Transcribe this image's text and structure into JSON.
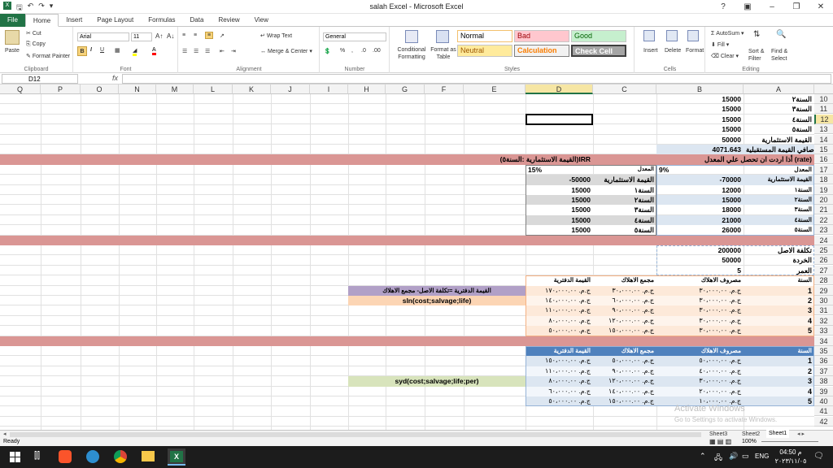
{
  "window": {
    "title": "salah Excel  -  Microsoft Excel"
  },
  "tabs": [
    "File",
    "Home",
    "Insert",
    "Page Layout",
    "Formulas",
    "Data",
    "Review",
    "View"
  ],
  "ribbon": {
    "clipboard": {
      "label": "Clipboard",
      "paste": "Paste",
      "cut": "Cut",
      "copy": "Copy",
      "format_painter": "Format Painter"
    },
    "font": {
      "label": "Font",
      "name": "Arial",
      "size": "11"
    },
    "alignment": {
      "label": "Alignment",
      "wrap": "Wrap Text",
      "merge": "Merge & Center"
    },
    "number": {
      "label": "Number",
      "format": "General"
    },
    "styles": {
      "label": "Styles",
      "conditional": "Conditional Formatting",
      "format_table": "Format as Table",
      "normal": "Normal",
      "bad": "Bad",
      "good": "Good",
      "neutral": "Neutral",
      "calculation": "Calculation",
      "check": "Check Cell"
    },
    "cells": {
      "label": "Cells",
      "insert": "Insert",
      "delete": "Delete",
      "format": "Format"
    },
    "editing": {
      "label": "Editing",
      "autosum": "AutoSum",
      "fill": "Fill",
      "clear": "Clear",
      "sort": "Sort & Filter",
      "find": "Find & Select"
    }
  },
  "formula_bar": {
    "name_box": "D12",
    "fx": "fx",
    "value": ""
  },
  "columns": [
    "Q",
    "P",
    "O",
    "N",
    "M",
    "L",
    "K",
    "J",
    "I",
    "H",
    "G",
    "F",
    "E",
    "D",
    "C",
    "B",
    "A"
  ],
  "rows": [
    "10",
    "11",
    "12",
    "13",
    "14",
    "15",
    "16",
    "17",
    "18",
    "19",
    "20",
    "21",
    "22",
    "23",
    "24",
    "25",
    "26",
    "27",
    "28",
    "29",
    "30",
    "31",
    "32",
    "33",
    "34",
    "35",
    "36",
    "37",
    "38",
    "39",
    "40",
    "41",
    "42"
  ],
  "cells": {
    "r10b": "15000",
    "r10a": "السنة٢",
    "r11b": "15000",
    "r11a": "السنة٣",
    "r12b": "15000",
    "r12a": "السنة٤",
    "r13b": "15000",
    "r13a": "السنة٥",
    "r14b": "50000",
    "r14a": "القيمة الاستثمارية",
    "r15b": "4071.643",
    "r15a": "صافي القيمة المستقبلية",
    "r16ab": "أذا اردت ان تحصل علي المعدل (rate)",
    "r16de": "(القيمة الاستثمارية :السنة٥)IRR",
    "r17d": "15%",
    "r17c": "المعدل",
    "r17b": "9%",
    "r17a": "المعدل",
    "r18d": "-50000",
    "r18c": "القيمة الاستثمارية",
    "r18b": "-70000",
    "r18a": "القيمة الاستثمارية",
    "r19d": "15000",
    "r19c": "السنة١",
    "r19b": "12000",
    "r19a": "السنة١",
    "r20d": "15000",
    "r20c": "السنة٢",
    "r20b": "15000",
    "r20a": "السنة٢",
    "r21d": "15000",
    "r21c": "السنة٣",
    "r21b": "18000",
    "r21a": "السنة٣",
    "r22d": "15000",
    "r22c": "السنة٤",
    "r22b": "21000",
    "r22a": "السنة٤",
    "r23d": "15000",
    "r23c": "السنة٥",
    "r23b": "26000",
    "r23a": "السنة٥",
    "r25b": "200000",
    "r25a": "تكلفة الاصل",
    "r26b": "50000",
    "r26a": "الخردة",
    "r27b": "5",
    "r27a": "العمر",
    "r28d": "القيمة الدفترية",
    "r28c": "مجمع الاهلاك",
    "r28b": "مصروف الاهلاك",
    "r28a": "السنة",
    "r29eh": "القيمة الدفترية =تكلفة الاصل- مجمع الاهلاك",
    "r30eh": "sln(cost;salvage;life)",
    "r35d": "القيمة الدفترية",
    "r35c": "مجمع الاهلاك",
    "r35b": "مصروف الاهلاك",
    "r35a": "السنة",
    "r38eh": "syd(cost;salvage;life;per)"
  },
  "sln_rows": [
    {
      "yr": "1",
      "dep": "ج.م.‏ ٣٠،٠٠٠.٠٠",
      "acc": "ج.م.‏ ٣٠،٠٠٠.٠٠",
      "book": "ج.م.‏ ١٧٠،٠٠٠.٠٠"
    },
    {
      "yr": "2",
      "dep": "ج.م.‏ ٣٠،٠٠٠.٠٠",
      "acc": "ج.م.‏ ٦٠،٠٠٠.٠٠",
      "book": "ج.م.‏ ١٤٠،٠٠٠.٠٠"
    },
    {
      "yr": "3",
      "dep": "ج.م.‏ ٣٠،٠٠٠.٠٠",
      "acc": "ج.م.‏ ٩٠،٠٠٠.٠٠",
      "book": "ج.م.‏ ١١٠،٠٠٠.٠٠"
    },
    {
      "yr": "4",
      "dep": "ج.م.‏ ٣٠،٠٠٠.٠٠",
      "acc": "ج.م.‏ ١٢٠،٠٠٠.٠٠",
      "book": "ج.م.‏ ٨٠،٠٠٠.٠٠"
    },
    {
      "yr": "5",
      "dep": "ج.م.‏ ٣٠،٠٠٠.٠٠",
      "acc": "ج.م.‏ ١٥٠،٠٠٠.٠٠",
      "book": "ج.م.‏ ٥٠،٠٠٠.٠٠"
    }
  ],
  "syd_rows": [
    {
      "yr": "1",
      "dep": "ج.م.‏ ٥٠،٠٠٠.٠٠",
      "acc": "ج.م.‏ ٥٠،٠٠٠.٠٠",
      "book": "ج.م.‏ ١٥٠،٠٠٠.٠٠"
    },
    {
      "yr": "2",
      "dep": "ج.م.‏ ٤٠،٠٠٠.٠٠",
      "acc": "ج.م.‏ ٩٠،٠٠٠.٠٠",
      "book": "ج.م.‏ ١١٠،٠٠٠.٠٠"
    },
    {
      "yr": "3",
      "dep": "ج.م.‏ ٣٠،٠٠٠.٠٠",
      "acc": "ج.م.‏ ١٢٠،٠٠٠.٠٠",
      "book": "ج.م.‏ ٨٠،٠٠٠.٠٠"
    },
    {
      "yr": "4",
      "dep": "ج.م.‏ ٢٠،٠٠٠.٠٠",
      "acc": "ج.م.‏ ١٤٠،٠٠٠.٠٠",
      "book": "ج.م.‏ ٦٠،٠٠٠.٠٠"
    },
    {
      "yr": "5",
      "dep": "ج.م.‏ ١٠،٠٠٠.٠٠",
      "acc": "ج.م.‏ ١٥٠،٠٠٠.٠٠",
      "book": "ج.م.‏ ٥٠،٠٠٠.٠٠"
    }
  ],
  "sheets": [
    "Sheet3",
    "Sheet2",
    "Sheet1"
  ],
  "status": {
    "ready": "Ready",
    "zoom": "100%"
  },
  "watermark": {
    "line1": "Activate Windows",
    "line2": "Go to Settings to activate Windows."
  },
  "taskbar": {
    "lang": "ENG",
    "time": "04:50 م",
    "date": "٢٠٢٣/١١/٠٥"
  },
  "colors": {
    "excel_green": "#217346",
    "band_red": "#da9694",
    "blue_cell": "#dce6f1",
    "header_blue": "#4f81bd",
    "lavender": "#b1a0c7",
    "peach": "#fcd5b4",
    "light_green": "#d8e4bc",
    "grey": "#d9d9d9"
  }
}
